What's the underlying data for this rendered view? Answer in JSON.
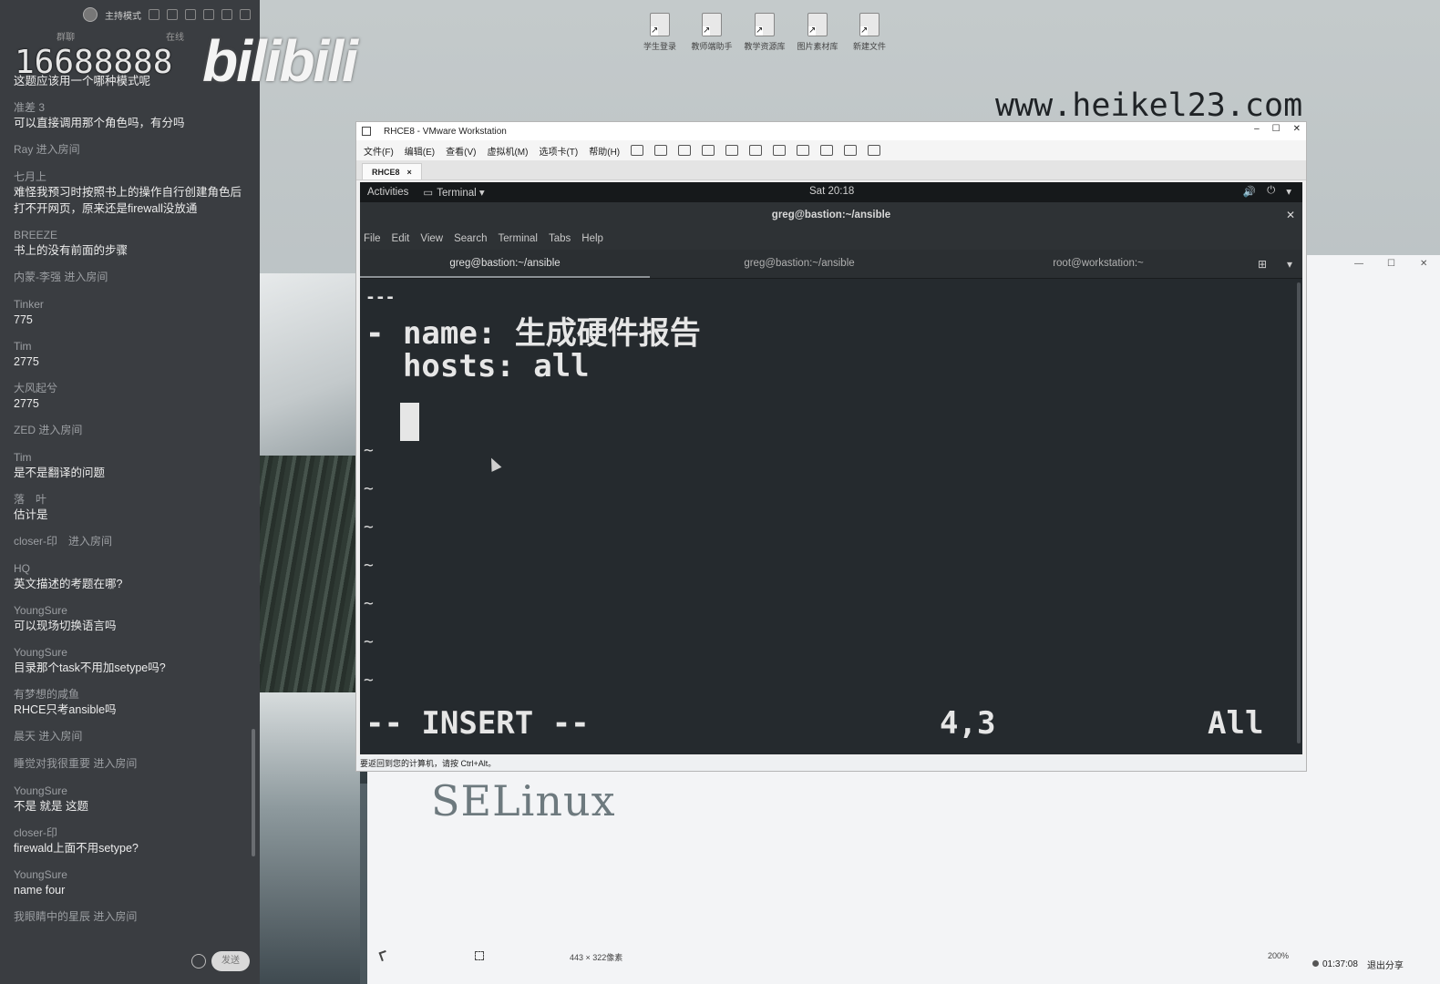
{
  "watermark": {
    "count": "16688888",
    "brand": "bilibili",
    "url": "www.heikel23.com"
  },
  "chat": {
    "header_mode": "主持模式",
    "tabs": [
      "群聊",
      "在线"
    ],
    "messages": [
      {
        "user": "",
        "text": "这题应该用一个哪种模式呢"
      },
      {
        "user": "准差 3",
        "text": "可以直接调用那个角色吗，有分吗"
      },
      {
        "user": "Ray 进入房间",
        "text": ""
      },
      {
        "user": "七月上",
        "text": "难怪我预习时按照书上的操作自行创建角色后打不开网页，原来还是firewall没放通"
      },
      {
        "user": "BREEZE",
        "text": "书上的没有前面的步骤"
      },
      {
        "user": "内蒙-李强 进入房间",
        "text": ""
      },
      {
        "user": "Tinker",
        "text": "775"
      },
      {
        "user": "Tim",
        "text": "2775"
      },
      {
        "user": "大风起兮",
        "text": "2775"
      },
      {
        "user": "ZED 进入房间",
        "text": ""
      },
      {
        "user": "Tim",
        "text": "是不是翻译的问题"
      },
      {
        "user": "落　叶",
        "text": "估计是"
      },
      {
        "user": "closer-印　进入房间",
        "text": ""
      },
      {
        "user": "HQ",
        "text": "英文描述的考题在哪?"
      },
      {
        "user": "YoungSure",
        "text": "可以现场切换语言吗"
      },
      {
        "user": "YoungSure",
        "text": "目录那个task不用加setype吗?"
      },
      {
        "user": "有梦想的咸鱼",
        "text": "RHCE只考ansible吗"
      },
      {
        "user": "晨天 进入房间",
        "text": ""
      },
      {
        "user": "睡觉对我很重要 进入房间",
        "text": ""
      },
      {
        "user": "YoungSure",
        "text": "不是 就是 这题"
      },
      {
        "user": "closer-印",
        "text": "firewald上面不用setype?"
      },
      {
        "user": "YoungSure",
        "text": "name four"
      },
      {
        "user": "我眼睛中的星辰 进入房间",
        "text": ""
      }
    ],
    "send_label": "发送"
  },
  "desktop_icons": [
    "学生登录",
    "教师端助手",
    "教学资源库",
    "图片素材库",
    "新建文件"
  ],
  "vmware": {
    "title": "RHCE8 - VMware Workstation",
    "menu": [
      "文件(F)",
      "编辑(E)",
      "查看(V)",
      "虚拟机(M)",
      "选项卡(T)",
      "帮助(H)"
    ],
    "tab": "RHCE8",
    "status_text": "要返回到您的计算机，请按 Ctrl+Alt。"
  },
  "gnome": {
    "activities": "Activities",
    "app_menu": "Terminal ▾",
    "clock": "Sat 20:18"
  },
  "terminal": {
    "window_title": "greg@bastion:~/ansible",
    "menu": [
      "File",
      "Edit",
      "View",
      "Search",
      "Terminal",
      "Tabs",
      "Help"
    ],
    "tabs": [
      "greg@bastion:~/ansible",
      "greg@bastion:~/ansible",
      "root@workstation:~"
    ],
    "vim": {
      "line1": "---",
      "line2": "- name: 生成硬件报告",
      "line3": "  hosts: all",
      "tilde": "~",
      "mode": "-- INSERT --",
      "position": "4,3",
      "scroll": "All"
    }
  },
  "paint": {
    "canvas_text": "SELinux",
    "selection_size": "443 × 322像素",
    "zoom": "200%"
  },
  "tray": {
    "time": "01:37:08",
    "exit_share": "退出分享"
  }
}
